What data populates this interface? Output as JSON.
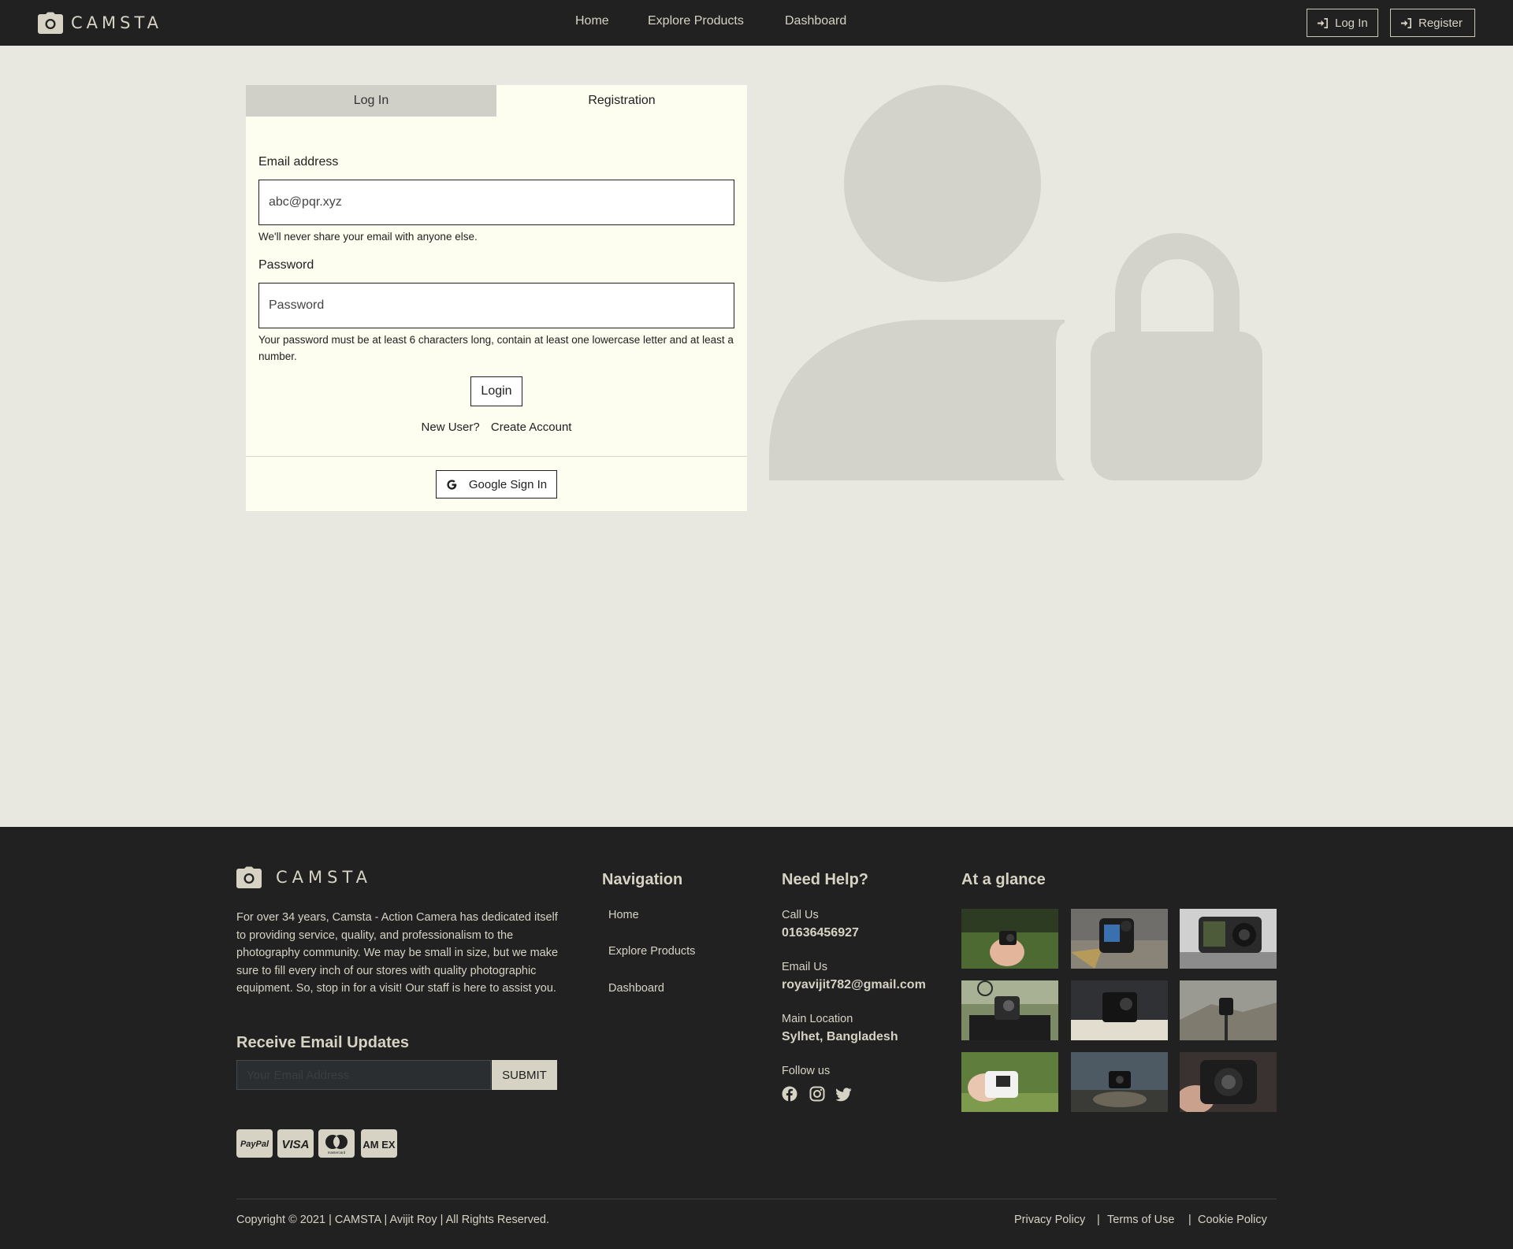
{
  "header": {
    "brand": "CAMSTA",
    "nav": [
      "Home",
      "Explore Products",
      "Dashboard"
    ],
    "login_label": "Log In",
    "register_label": "Register"
  },
  "auth": {
    "tabs": [
      "Log In",
      "Registration"
    ],
    "email_label": "Email address",
    "email_value": "abc@pqr.xyz",
    "email_help": "We'll never share your email with anyone else.",
    "password_label": "Password",
    "password_placeholder": "Password",
    "password_help": "Your password must be at least 6 characters long, contain at least one lowercase letter and at least a number.",
    "login_button": "Login",
    "new_user": "New User?",
    "create_account": "Create Account",
    "google_button": "Google Sign In"
  },
  "footer": {
    "brand": "CAMSTA",
    "about": "For over 34 years, Camsta - Action Camera has dedicated itself to providing service, quality, and professionalism to the photography community. We may be small in size, but we make sure to fill every inch of our stores with quality photographic equipment. So, stop in for a visit! Our staff is here to assist you.",
    "updates_heading": "Receive Email Updates",
    "updates_placeholder": "Your Email Address",
    "submit_label": "SUBMIT",
    "payment_icons": [
      "paypal-icon",
      "visa-icon",
      "mastercard-icon",
      "amex-icon"
    ],
    "payment_labels": {
      "paypal": "PayPal",
      "visa": "VISA",
      "mastercard": "mastercard",
      "amex": "AM EX"
    },
    "navigation_heading": "Navigation",
    "navigation": [
      "Home",
      "Explore Products",
      "Dashboard"
    ],
    "help_heading": "Need Help?",
    "call_label": "Call Us",
    "call_value": "01636456927",
    "email_label": "Email Us",
    "email_value": "royavijit782@gmail.com",
    "location_label": "Main Location",
    "location_value": "Sylhet, Bangladesh",
    "follow_label": "Follow us",
    "social_icons": [
      "facebook-icon",
      "instagram-icon",
      "twitter-icon"
    ],
    "glance_heading": "At a glance",
    "copyright": "Copyright © 2021 | CAMSTA | Avijit Roy | All Rights Reserved.",
    "legal": [
      "Privacy Policy",
      "Terms of Use",
      "Cookie Policy"
    ]
  },
  "colors": {
    "dark": "#212121",
    "accent": "#d6d3c4",
    "page_bg": "#e8e7e0",
    "card_bg": "#fdfef0",
    "illustration": "#d3d2cb"
  }
}
